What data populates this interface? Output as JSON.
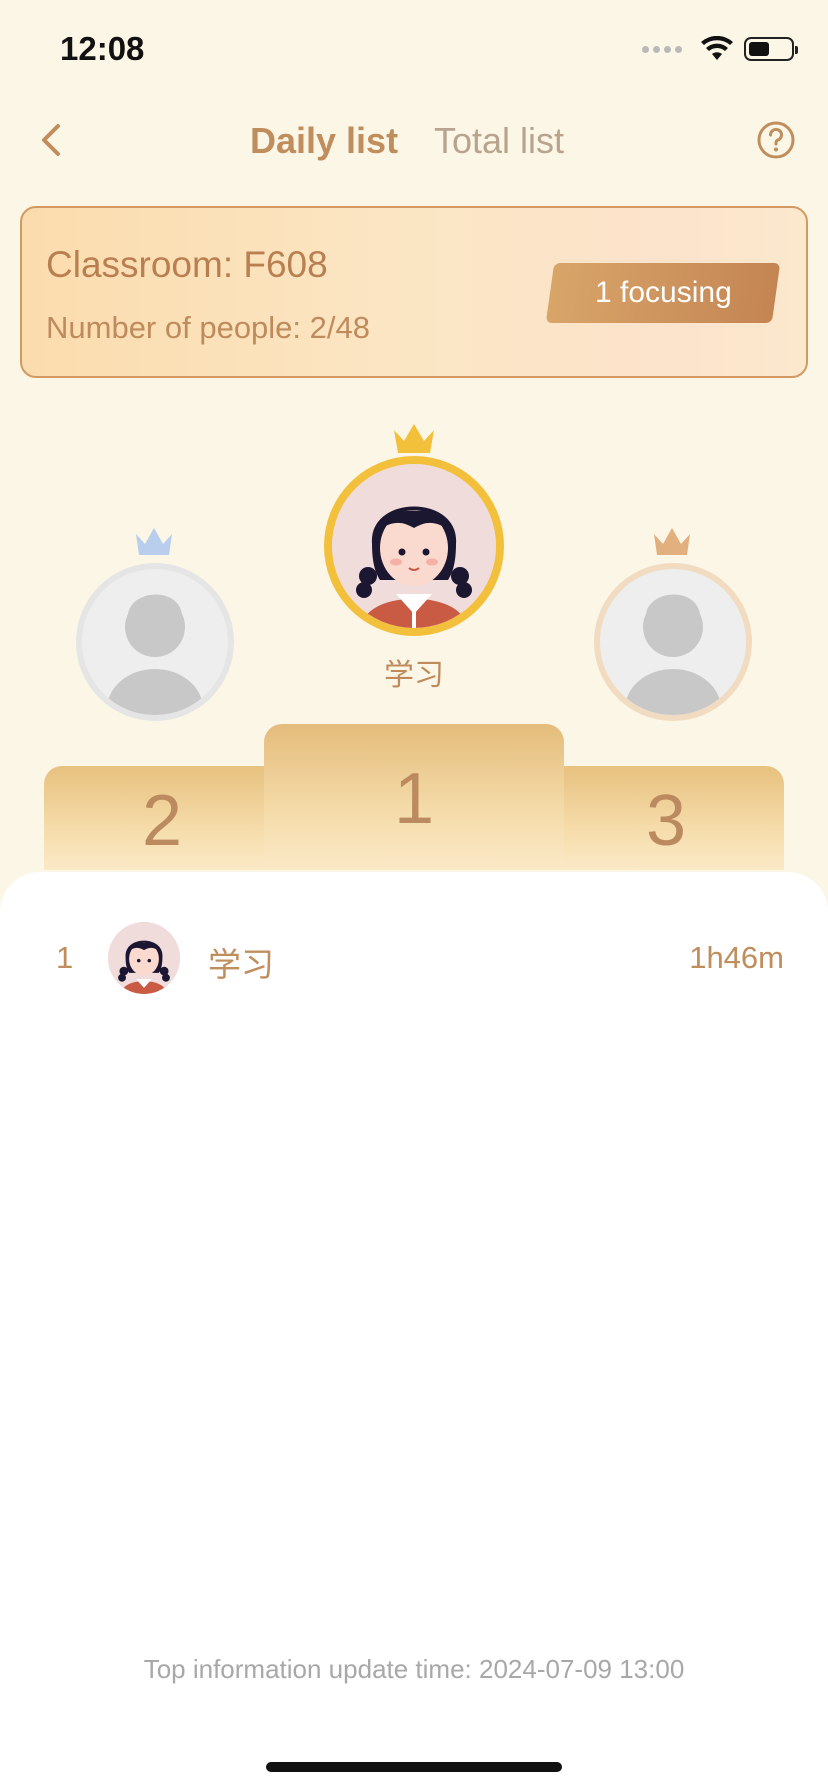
{
  "status_bar": {
    "time": "12:08"
  },
  "nav": {
    "tabs": [
      {
        "label": "Daily list",
        "active": true
      },
      {
        "label": "Total list",
        "active": false
      }
    ]
  },
  "classroom": {
    "title": "Classroom: F608",
    "people": "Number of people: 2/48",
    "focusing_badge": "1 focusing"
  },
  "podium": {
    "winner_name": "学习",
    "places": [
      "1",
      "2",
      "3"
    ]
  },
  "ranking": [
    {
      "rank": "1",
      "name": "学习",
      "time": "1h46m"
    }
  ],
  "footer": {
    "update_time": "Top information update time: 2024-07-09 13:00"
  },
  "colors": {
    "background": "#fcf6e6",
    "accent": "#c08d5d",
    "gold": "#f3c03c",
    "silver_crown": "#b9cdec",
    "bronze_crown": "#e2b07e"
  }
}
